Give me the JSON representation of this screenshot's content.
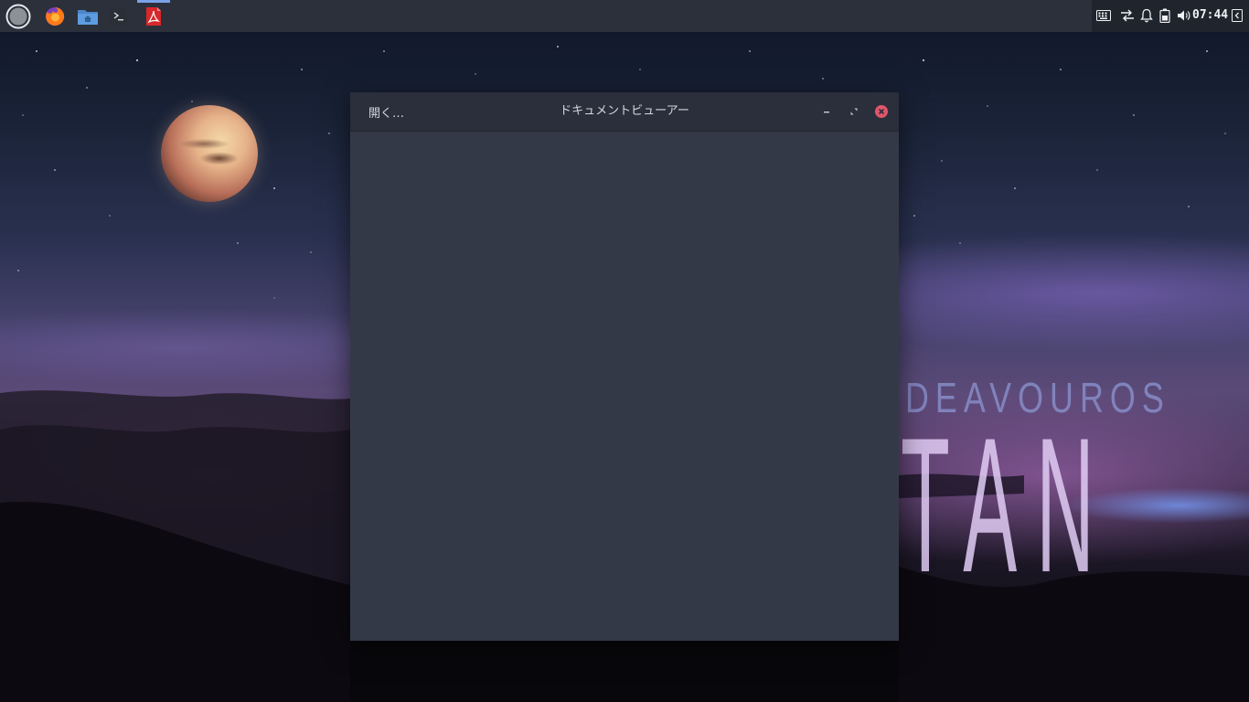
{
  "wallpaper": {
    "brand_line": "DEAVOUROS",
    "edition_line": "TAN"
  },
  "panel": {
    "launchers": [
      {
        "name": "menu",
        "icon": "endeavour-menu-icon"
      },
      {
        "name": "firefox",
        "icon": "firefox-icon"
      },
      {
        "name": "files",
        "icon": "folder-home-icon"
      },
      {
        "name": "terminal",
        "icon": "terminal-icon"
      },
      {
        "name": "document-viewer",
        "icon": "pdf-icon",
        "active": true
      }
    ],
    "tray": {
      "icons": [
        "keyboard-icon",
        "network-icon",
        "notification-bell-icon",
        "battery-icon",
        "volume-icon"
      ],
      "clock": "07:44",
      "show_desktop_icon": "panel-collapse-icon"
    },
    "colors": {
      "panel_bg": "#2b303b",
      "active_indicator": "#7aa2e8",
      "pdf_red": "#d6282b"
    }
  },
  "window": {
    "title": "ドキュメントビューアー",
    "open_label": "開く…",
    "controls": {
      "minimize_icon": "minimize-icon",
      "maximize_icon": "maximize-icon",
      "close_icon": "close-icon"
    },
    "colors": {
      "header_bg": "#2b2f3b",
      "content_bg": "#343947",
      "close_red": "#e0566a"
    }
  }
}
